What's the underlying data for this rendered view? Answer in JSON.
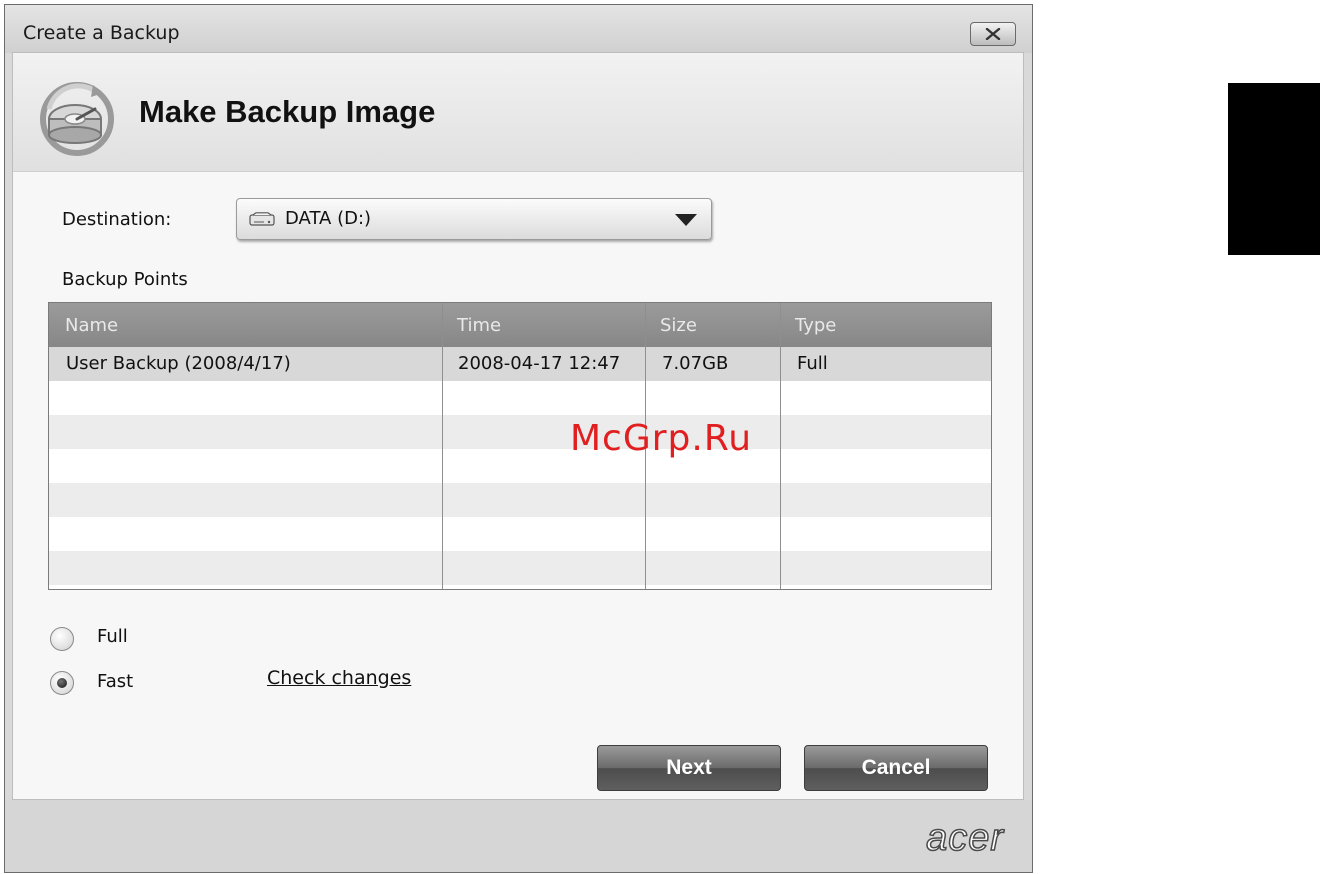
{
  "window": {
    "title": "Create a Backup",
    "close_label": "×"
  },
  "banner": {
    "title": "Make Backup Image",
    "icon": "backup-disk-icon"
  },
  "destination": {
    "label": "Destination:",
    "value": "DATA (D:)",
    "icon": "hard-drive-icon"
  },
  "backup_points": {
    "label": "Backup Points",
    "columns": [
      "Name",
      "Time",
      "Size",
      "Type"
    ],
    "rows": [
      [
        "User Backup (2008/4/17)",
        "2008-04-17 12:47",
        "7.07GB",
        "Full"
      ]
    ],
    "selected_row": 0
  },
  "mode": {
    "options": [
      "Full",
      "Fast"
    ],
    "selected": "Fast",
    "check_changes_label": "Check changes"
  },
  "buttons": {
    "next": "Next",
    "cancel": "Cancel"
  },
  "brand": {
    "logo_text": "acer"
  },
  "watermark": "McGrp.Ru",
  "colors": {
    "header_bg": "#8f8f8f",
    "selected_row": "#d8d8d8",
    "button_dark": "#5a5a5a",
    "watermark": "#e02020"
  }
}
